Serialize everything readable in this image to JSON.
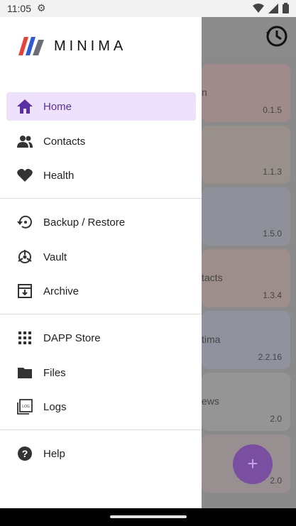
{
  "status_bar": {
    "time": "11:05",
    "icons": [
      "gear-icon",
      "wifi-icon",
      "cell-signal-icon",
      "battery-icon"
    ]
  },
  "drawer": {
    "brand": "MINIMA",
    "sections": [
      [
        {
          "label": "Home",
          "icon": "home-icon",
          "active": true
        },
        {
          "label": "Contacts",
          "icon": "contacts-icon"
        },
        {
          "label": "Health",
          "icon": "heart-icon"
        }
      ],
      [
        {
          "label": "Backup / Restore",
          "icon": "backup-restore-icon"
        },
        {
          "label": "Vault",
          "icon": "vault-icon"
        },
        {
          "label": "Archive",
          "icon": "archive-icon"
        }
      ],
      [
        {
          "label": "DAPP Store",
          "icon": "grid-icon"
        },
        {
          "label": "Files",
          "icon": "folder-icon"
        },
        {
          "label": "Logs",
          "icon": "logs-icon"
        }
      ],
      [
        {
          "label": "Help",
          "icon": "help-icon"
        }
      ]
    ]
  },
  "background_list": [
    {
      "name": "n",
      "version": "0.1.5"
    },
    {
      "name": "",
      "version": "1.1.3"
    },
    {
      "name": "",
      "version": "1.5.0"
    },
    {
      "name": "tacts",
      "version": "1.3.4"
    },
    {
      "name": "tima",
      "version": "2.2.16"
    },
    {
      "name": "ews",
      "version": "2.0"
    },
    {
      "name": "",
      "version": "2.0"
    }
  ],
  "fab": {
    "label": "+"
  },
  "colors": {
    "accent": "#5a2ea6",
    "active_bg": "#ede1fb",
    "fab": "#7a4ea0"
  },
  "logs_icon_text": "LOG"
}
